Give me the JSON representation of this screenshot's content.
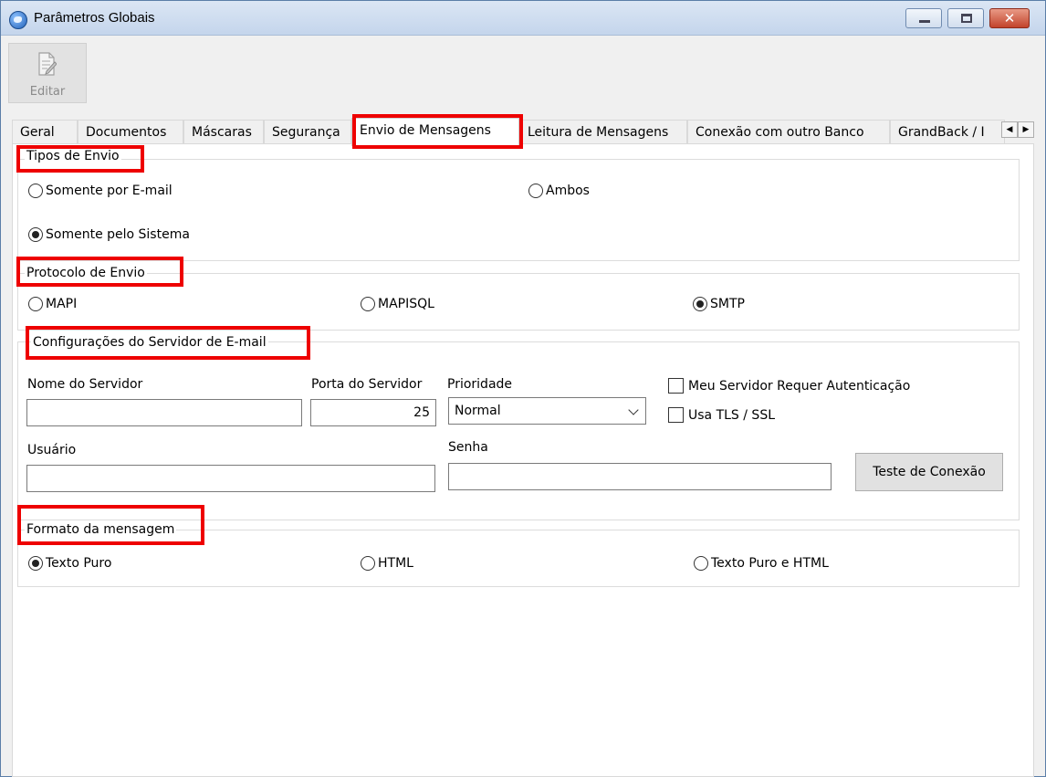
{
  "window": {
    "title": "Parâmetros Globais",
    "close_glyph": "✕"
  },
  "toolbar": {
    "edit_label": "Editar",
    "edit_icon": "edit-document-icon"
  },
  "tabs": [
    {
      "label": "Geral"
    },
    {
      "label": "Documentos"
    },
    {
      "label": "Máscaras"
    },
    {
      "label": "Segurança"
    },
    {
      "label": "Envio de Mensagens"
    },
    {
      "label": "Leitura de Mensagens"
    },
    {
      "label": "Conexão com outro Banco"
    },
    {
      "label": "GrandBack / I"
    }
  ],
  "tab_scroll": {
    "left": "◀",
    "right": "▶"
  },
  "tipos_envio": {
    "legend": "Tipos de Envio",
    "email_only": "Somente por E-mail",
    "both": "Ambos",
    "system_only": "Somente pelo Sistema",
    "selected": "system_only"
  },
  "protocolo": {
    "legend": "Protocolo de Envio",
    "mapi": "MAPI",
    "mapisql": "MAPISQL",
    "smtp": "SMTP",
    "selected": "smtp"
  },
  "servidor": {
    "legend": "Configurações do Servidor de E-mail",
    "server_name_label": "Nome do Servidor",
    "server_name_value": "",
    "port_label": "Porta do Servidor",
    "port_value": "25",
    "priority_label": "Prioridade",
    "priority_value": "Normal",
    "auth_label": "Meu Servidor Requer Autenticação",
    "tls_label": "Usa TLS / SSL",
    "user_label": "Usuário",
    "user_value": "",
    "password_label": "Senha",
    "password_value": "",
    "test_button": "Teste de Conexão"
  },
  "formato": {
    "legend": "Formato da mensagem",
    "plain": "Texto Puro",
    "html": "HTML",
    "plain_html": "Texto Puro e HTML",
    "selected": "plain"
  },
  "highlight_color": "#ee0000"
}
